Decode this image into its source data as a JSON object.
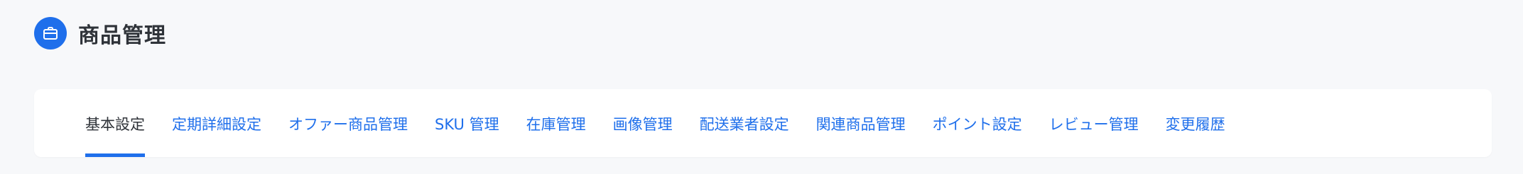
{
  "header": {
    "icon": "briefcase-icon",
    "title": "商品管理"
  },
  "tabs": [
    {
      "label": "基本設定",
      "active": true
    },
    {
      "label": "定期詳細設定",
      "active": false
    },
    {
      "label": "オファー商品管理",
      "active": false
    },
    {
      "label": "SKU 管理",
      "active": false
    },
    {
      "label": "在庫管理",
      "active": false
    },
    {
      "label": "画像管理",
      "active": false
    },
    {
      "label": "配送業者設定",
      "active": false
    },
    {
      "label": "関連商品管理",
      "active": false
    },
    {
      "label": "ポイント設定",
      "active": false
    },
    {
      "label": "レビュー管理",
      "active": false
    },
    {
      "label": "変更履歴",
      "active": false
    }
  ],
  "colors": {
    "accent": "#1f6feb",
    "background": "#f7f8fa",
    "active_text": "#2f3339"
  }
}
